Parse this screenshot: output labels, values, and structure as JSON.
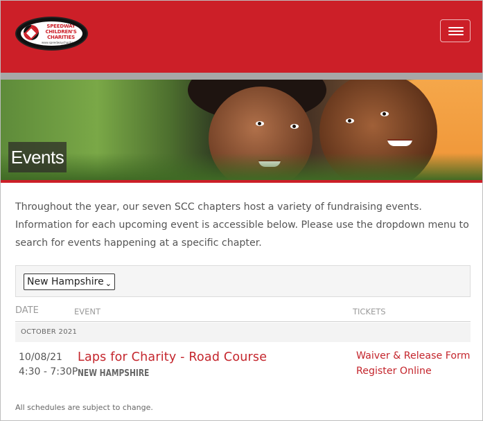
{
  "header": {
    "logo_text": "SPEEDWAY CHILDREN'S CHARITIES",
    "logo_url_text": "www.speedwaycharities.org",
    "menu_icon": "hamburger-menu-icon",
    "brand_color": "#cc1f28"
  },
  "banner": {
    "title": "Events"
  },
  "intro": {
    "text": "Throughout the year, our seven SCC chapters host a variety of fundraising events. Information for each upcoming event is accessible below. Please use the dropdown menu to search for events happening at a specific chapter."
  },
  "filter": {
    "chapter_selected": "New Hampshire",
    "chevron_icon": "chevron-down-icon"
  },
  "table": {
    "headers": {
      "date": "DATE",
      "event": "EVENT",
      "tickets": "TICKETS"
    },
    "month": "OCTOBER 2021",
    "rows": [
      {
        "date": "10/08/21",
        "time": "4:30 - 7:30P",
        "event_name": "Laps for Charity - Road Course",
        "chapter": "NEW HAMPSHIRE",
        "ticket_links": [
          "Waiver & Release Form",
          "Register Online"
        ]
      }
    ]
  },
  "footer": {
    "note": "All schedules are subject to change."
  },
  "colors": {
    "accent_red": "#cc1f28",
    "link_red": "#c4252c",
    "band_gray": "#a7a7a7"
  }
}
